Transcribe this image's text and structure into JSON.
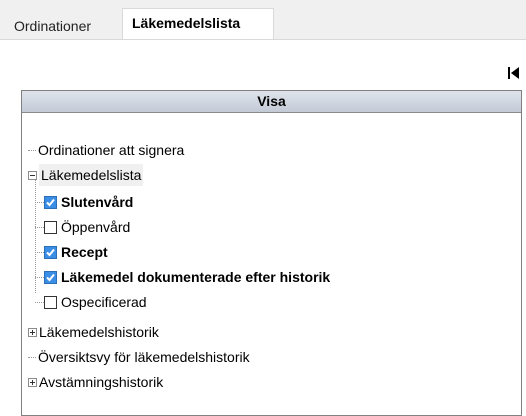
{
  "tabs": [
    {
      "label": "Ordinationer",
      "active": false
    },
    {
      "label": "Läkemedelslista",
      "active": true
    }
  ],
  "panel": {
    "header": "Visa",
    "collapse_icon": "collapse-left-icon"
  },
  "tree": {
    "n0": {
      "label": "Ordinationer att signera"
    },
    "n1": {
      "label": "Läkemedelslista",
      "expanded": true
    },
    "n1c0": {
      "label": "Slutenvård",
      "checked": true
    },
    "n1c1": {
      "label": "Öppenvård",
      "checked": false
    },
    "n1c2": {
      "label": "Recept",
      "checked": true
    },
    "n1c3": {
      "label": "Läkemedel dokumenterade efter historik",
      "checked": true
    },
    "n1c4": {
      "label": "Ospecificerad",
      "checked": false
    },
    "n2": {
      "label": "Läkemedelshistorik",
      "expanded": false
    },
    "n3": {
      "label": "Översiktsvy för läkemedelshistorik"
    },
    "n4": {
      "label": "Avstämningshistorik",
      "expanded": false
    }
  },
  "colors": {
    "check_fill": "#3a8ee6",
    "header_bg": "#c9d0dc",
    "tab_bg": "#f0f0f0"
  }
}
